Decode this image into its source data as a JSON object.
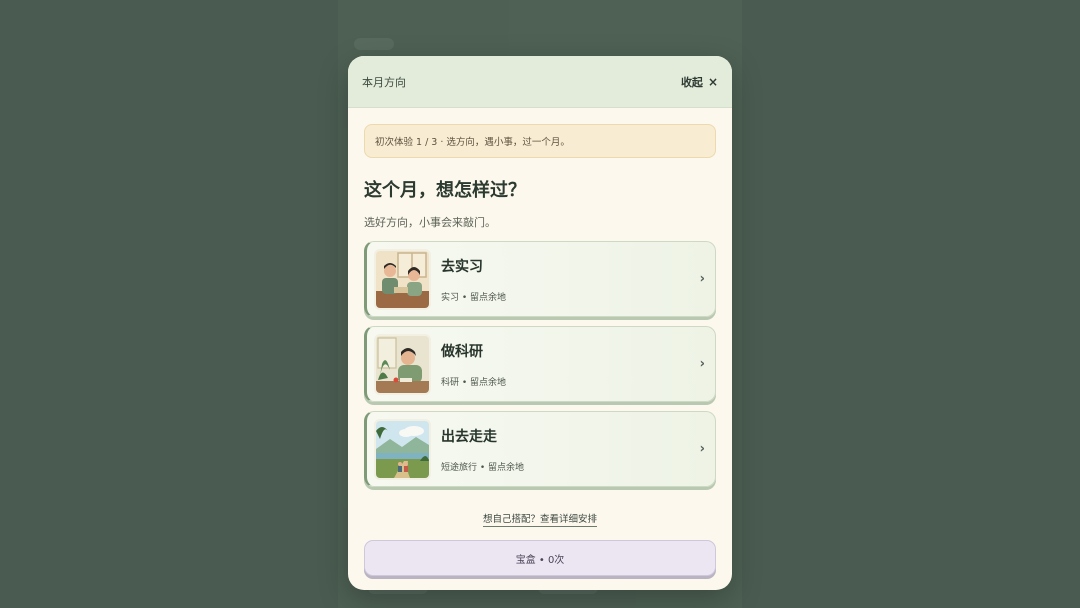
{
  "header": {
    "title": "本月方向",
    "collapse_label": "收起",
    "close_glyph": "×"
  },
  "notice": {
    "text": "初次体验 1 / 3 · 选方向，遇小事，过一个月。"
  },
  "main": {
    "title": "这个月，想怎样过？",
    "subtitle": "选好方向，小事会来敲门。"
  },
  "options": [
    {
      "title": "去实习",
      "tag": "实习 • 留点余地",
      "icon": "internship-illustration"
    },
    {
      "title": "做科研",
      "tag": "科研 • 留点余地",
      "icon": "research-illustration"
    },
    {
      "title": "出去走走",
      "tag": "短途旅行 • 留点余地",
      "icon": "travel-illustration"
    }
  ],
  "link": {
    "text": "想自己搭配？查看详细安排"
  },
  "treasure": {
    "text": "宝盒 • 0次"
  },
  "colors": {
    "header_bg": "#e3ecdb",
    "notice_bg": "#f8ecd2",
    "accent_green": "#7e9a77",
    "treasure_bg": "#ece6f2"
  }
}
